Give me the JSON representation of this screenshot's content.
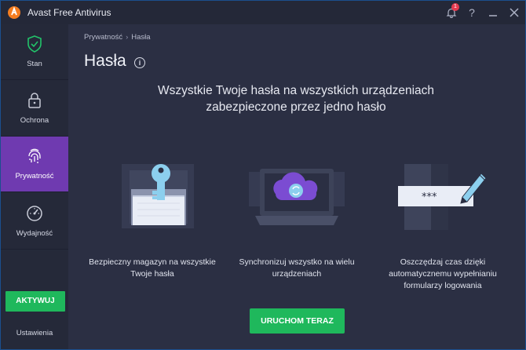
{
  "app": {
    "title": "Avast Free Antivirus",
    "notification_count": "1"
  },
  "sidebar": {
    "items": [
      {
        "label": "Stan"
      },
      {
        "label": "Ochrona"
      },
      {
        "label": "Prywatność"
      },
      {
        "label": "Wydajność"
      }
    ],
    "activate_label": "AKTYWUJ",
    "settings_label": "Ustawienia"
  },
  "breadcrumb": {
    "parent": "Prywatność",
    "separator": "›",
    "current": "Hasła"
  },
  "page": {
    "title": "Hasła",
    "headline_line1": "Wszystkie Twoje hasła na wszystkich urządzeniach",
    "headline_line2": "zabezpieczone przez jedno hasło"
  },
  "features": [
    {
      "line1": "Bezpieczny magazyn na wszystkie",
      "line2": "Twoje hasła",
      "line3": ""
    },
    {
      "line1": "Synchronizuj wszystko na wielu",
      "line2": "urządzeniach",
      "line3": ""
    },
    {
      "line1": "Oszczędzaj czas dzięki",
      "line2": "automatycznemu wypełnianiu",
      "line3": "formularzy logowania"
    }
  ],
  "password_mask": "***",
  "cta_label": "URUCHOM TERAZ",
  "colors": {
    "accent_green": "#1fb85c",
    "active_purple": "#6f3ab0",
    "key_blue": "#8ccfee"
  },
  "icons": [
    "avast-logo-icon",
    "bell-icon",
    "help-icon",
    "minimize-icon",
    "close-icon",
    "shield-check-icon",
    "lock-icon",
    "fingerprint-icon",
    "speedometer-icon",
    "info-icon"
  ]
}
